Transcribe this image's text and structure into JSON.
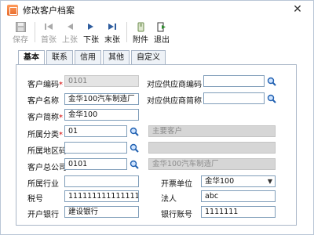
{
  "window": {
    "title": "修改客户档案"
  },
  "toolbar": {
    "save": "保存",
    "first": "首张",
    "prev": "上张",
    "next": "下张",
    "last": "末张",
    "attachment": "附件",
    "exit": "退出"
  },
  "tabs": [
    "基本",
    "联系",
    "信用",
    "其他",
    "自定义"
  ],
  "form": {
    "customer_code_label": "客户编码",
    "customer_code": "0101",
    "customer_name_label": "客户名称",
    "customer_name": "金华100汽车制造厂",
    "customer_short_label": "客户简称",
    "customer_short": "金华100",
    "category_label": "所属分类",
    "category": "01",
    "category_name": "主要客户",
    "region_label": "所属地区码",
    "region": "",
    "region_name": "",
    "parent_label": "客户总公司",
    "parent": "0101",
    "parent_name": "金华100汽车制造厂",
    "industry_label": "所属行业",
    "industry": "",
    "tax_label": "税号",
    "tax": "1111111111111111",
    "bank_label": "开户银行",
    "bank": "建设银行",
    "supplier_code_label": "对应供应商编码",
    "supplier_code": "",
    "supplier_short_label": "对应供应商简称",
    "supplier_short": "",
    "billing_unit_label": "开票单位",
    "billing_unit": "金华100",
    "legal_label": "法人",
    "legal": "abc",
    "account_label": "银行账号",
    "account": "1111111"
  },
  "colors": {
    "accent": "#2f5d9e",
    "required": "#d40000"
  }
}
